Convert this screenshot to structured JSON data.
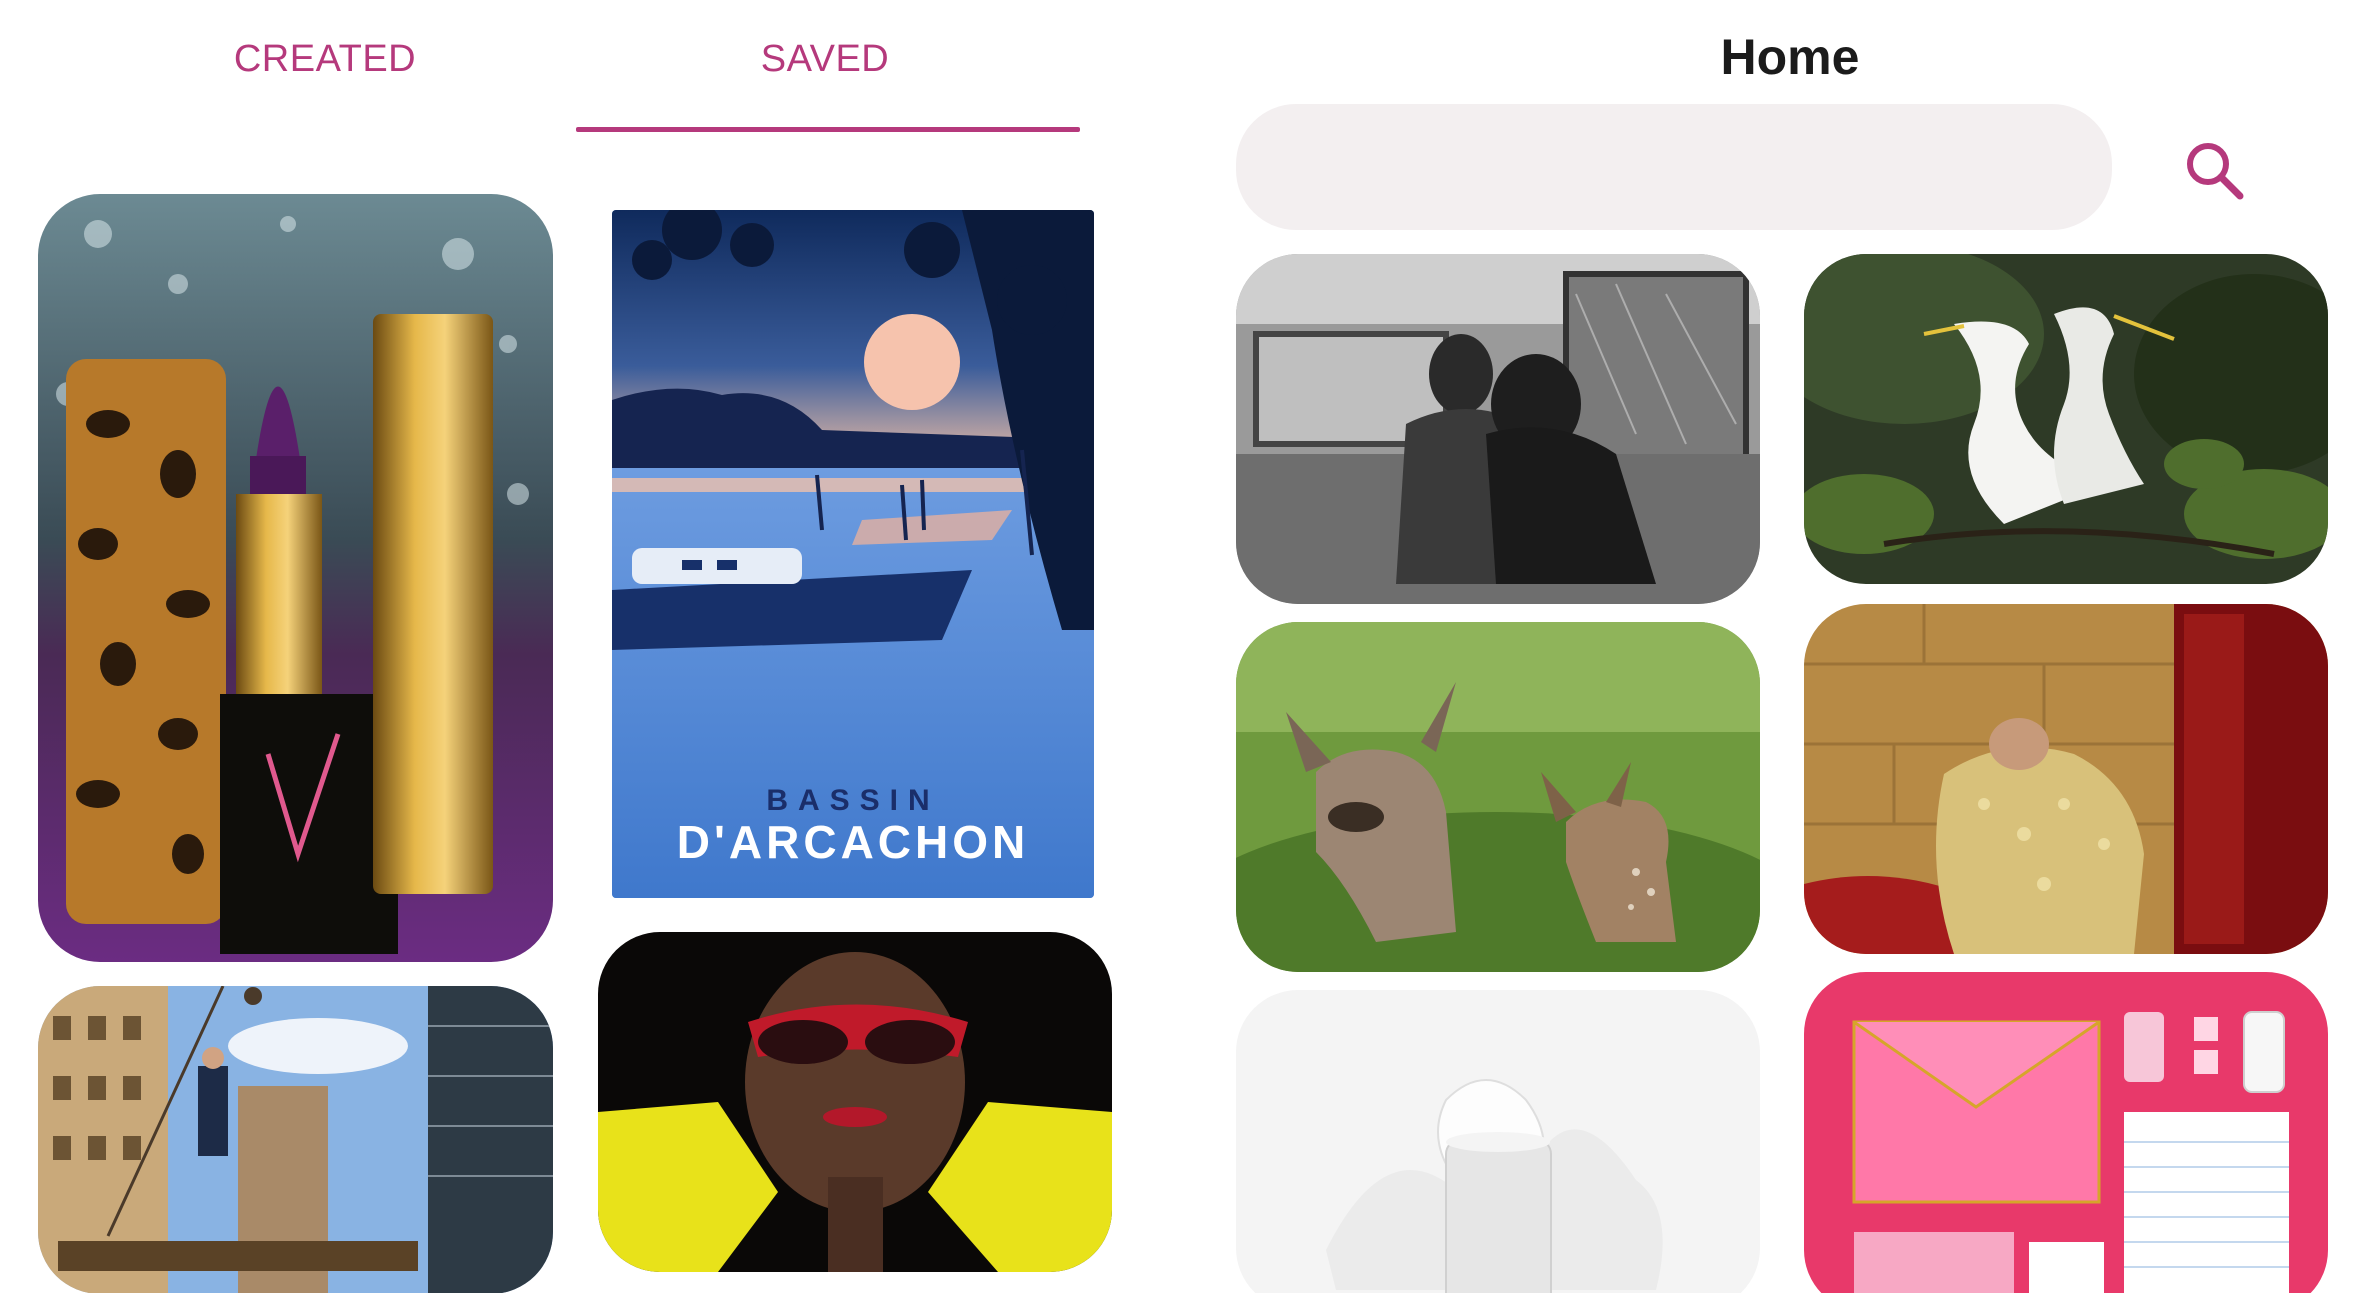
{
  "profile": {
    "tabs": [
      {
        "label": "CREATED",
        "active": false
      },
      {
        "label": "SAVED",
        "active": true
      }
    ],
    "accent_color": "#b5397c",
    "pins": [
      {
        "subject": "lipstick-photo"
      },
      {
        "subject": "poster",
        "poster_line1": "BASSIN",
        "poster_line2": "D'ARCACHON"
      },
      {
        "subject": "city-crane-photo"
      },
      {
        "subject": "portrait-sunglasses-photo"
      }
    ]
  },
  "home": {
    "title": "Home",
    "search": {
      "value": "",
      "placeholder": ""
    },
    "search_icon": "search-icon",
    "feed": [
      {
        "subject": "man-with-gorilla-photo"
      },
      {
        "subject": "egrets-photo"
      },
      {
        "subject": "deer-photo"
      },
      {
        "subject": "matador-photo"
      },
      {
        "subject": "product-splash-photo"
      },
      {
        "subject": "pink-desk-photo"
      }
    ]
  }
}
